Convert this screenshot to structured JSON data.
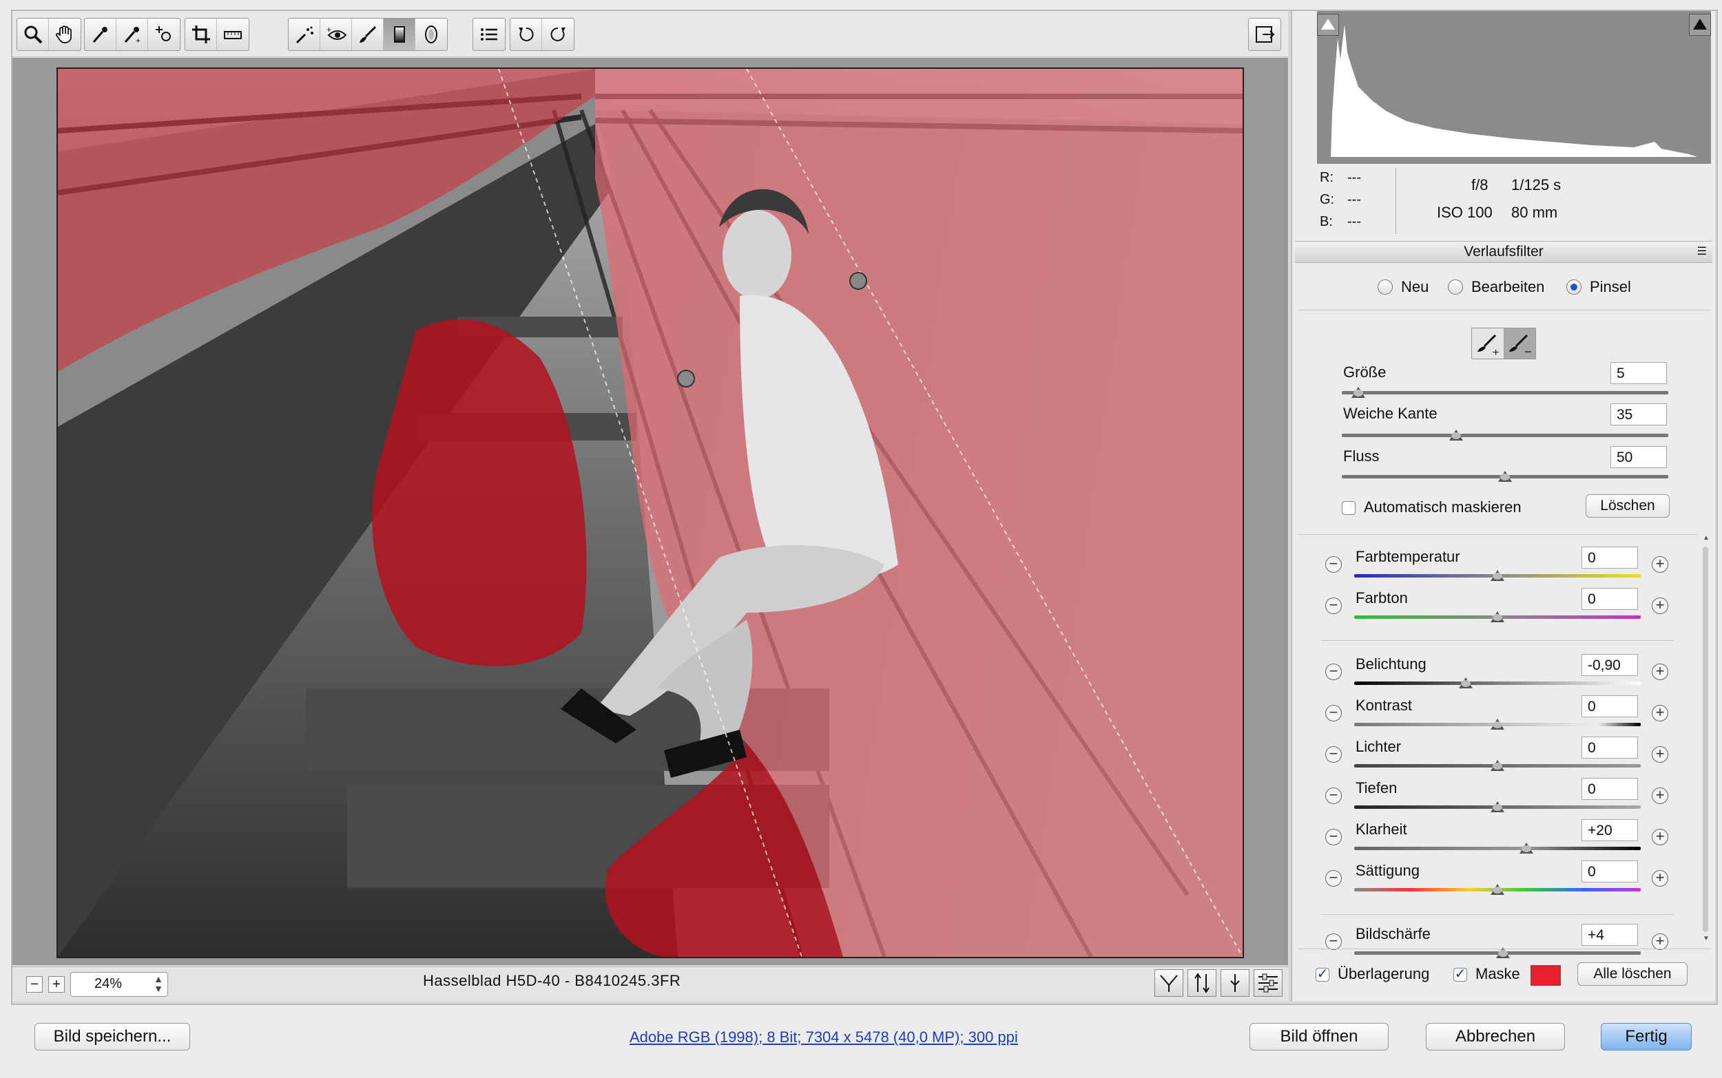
{
  "toolbar": {
    "tools": [
      "zoom-icon",
      "hand-icon",
      "white-balance-icon",
      "color-sampler-icon",
      "targeted-adjustment-icon",
      "crop-icon",
      "straighten-icon",
      "spot-removal-icon",
      "red-eye-icon",
      "adjustment-brush-icon",
      "graduated-filter-icon",
      "radial-filter-icon",
      "preferences-icon",
      "rotate-left-icon",
      "rotate-right-icon"
    ],
    "active_tool": "graduated-filter-icon"
  },
  "preview": {
    "zoom": "24%",
    "filename": "Hasselblad H5D-40  -  B8410245.3FR",
    "overlay_color": "#cc2233"
  },
  "histogram": {
    "r_label": "R:",
    "r_val": "---",
    "g_label": "G:",
    "g_val": "---",
    "b_label": "B:",
    "b_val": "---",
    "aperture": "f/8",
    "shutter": "1/125 s",
    "iso": "ISO 100",
    "focal": "80 mm"
  },
  "panel": {
    "title": "Verlaufsfilter",
    "mode_neu": "Neu",
    "mode_bearbeiten": "Bearbeiten",
    "mode_pinsel": "Pinsel",
    "selected_mode": "Pinsel",
    "brush": {
      "groesse_label": "Größe",
      "groesse": "5",
      "groesse_pos": 0.05,
      "weiche_label": "Weiche Kante",
      "weiche": "35",
      "weiche_pos": 0.35,
      "fluss_label": "Fluss",
      "fluss": "50",
      "fluss_pos": 0.5,
      "automask_label": "Automatisch maskieren",
      "loeschen_label": "Löschen"
    },
    "adjustments": [
      {
        "label": "Farbtemperatur",
        "value": "0",
        "pos": 0.5
      },
      {
        "label": "Farbton",
        "value": "0",
        "pos": 0.5
      },
      {
        "label": "Belichtung",
        "value": "-0,90",
        "pos": 0.39
      },
      {
        "label": "Kontrast",
        "value": "0",
        "pos": 0.5
      },
      {
        "label": "Lichter",
        "value": "0",
        "pos": 0.5
      },
      {
        "label": "Tiefen",
        "value": "0",
        "pos": 0.5
      },
      {
        "label": "Klarheit",
        "value": "+20",
        "pos": 0.6
      },
      {
        "label": "Sättigung",
        "value": "0",
        "pos": 0.5
      },
      {
        "label": "Bildschärfe",
        "value": "+4",
        "pos": 0.52
      }
    ],
    "overlay_label": "Überlagerung",
    "mask_label": "Maske",
    "mask_color": "#e8202e",
    "clear_all_label": "Alle löschen"
  },
  "footer": {
    "save_label": "Bild speichern...",
    "info": "Adobe RGB (1998); 8 Bit; 7304 x 5478 (40,0 MP); 300 ppi",
    "open_label": "Bild öffnen",
    "cancel_label": "Abbrechen",
    "done_label": "Fertig"
  }
}
